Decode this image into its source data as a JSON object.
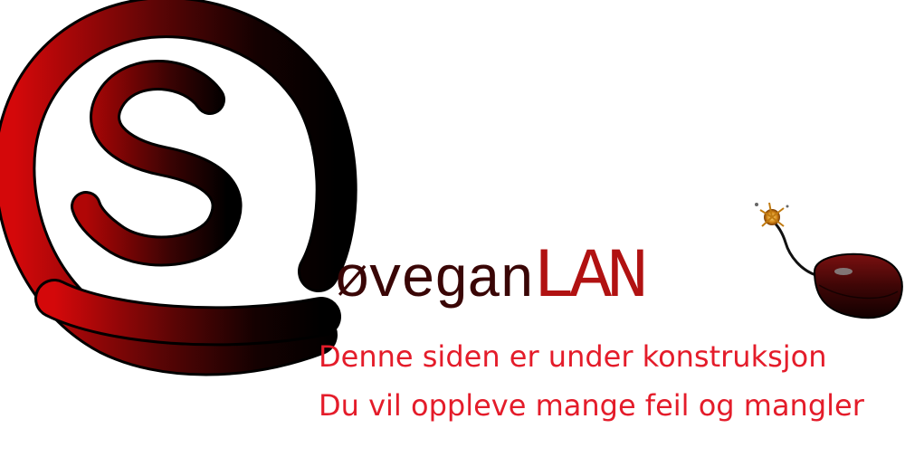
{
  "logo": {
    "wordmark_part1": "øvegan",
    "wordmark_part2": "LAN",
    "icons": [
      "s-circle-emblem-icon",
      "bomb-mouse-icon"
    ],
    "colors": {
      "red": "#d10a0a",
      "dark_red": "#3a0606",
      "black": "#000000",
      "lan_red": "#b11212"
    }
  },
  "notice": {
    "line1": "Denne siden er under konstruksjon",
    "line2": "Du vil oppleve mange feil og mangler",
    "color": "#e41c2a"
  }
}
